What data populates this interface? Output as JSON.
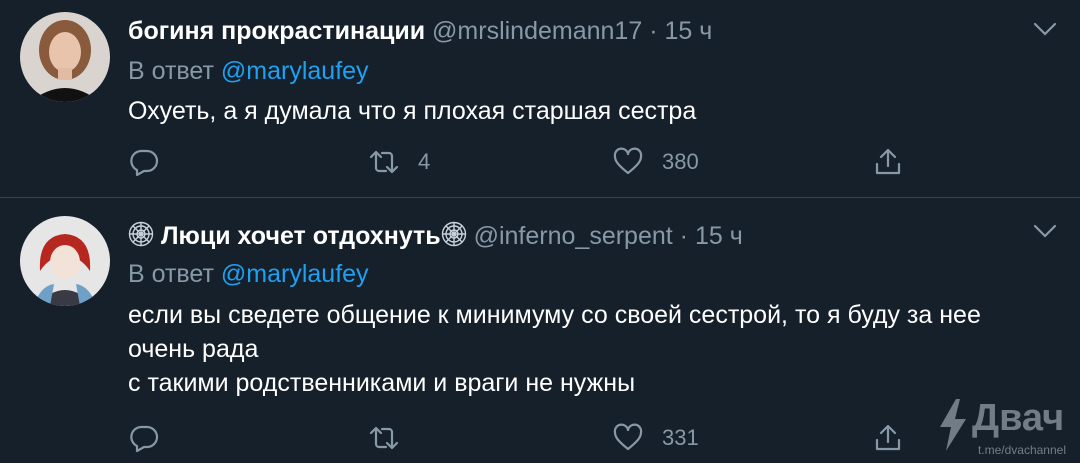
{
  "tweets": [
    {
      "name": "богиня прокрастинации",
      "handle": "@mrslindemann17",
      "dot": "·",
      "time": "15 ч",
      "reply_prefix": "В ответ",
      "reply_to": "@marylaufey",
      "text_lines": [
        "Охуеть, а я думала что я плохая старшая сестра"
      ],
      "retweets": "4",
      "likes": "380"
    },
    {
      "name": "Люци хочет отдохнуть",
      "handle": "@inferno_serpent",
      "dot": "·",
      "time": "15 ч",
      "reply_prefix": "В ответ",
      "reply_to": "@marylaufey",
      "text_lines": [
        "если вы сведете общение к минимуму со своей сестрой, то я буду за нее",
        "очень рада",
        "с такими родственниками и враги не нужны"
      ],
      "retweets": "",
      "likes": "331"
    }
  ],
  "watermark": {
    "brand": "Двач",
    "url": "t.me/dvachannel"
  },
  "colors": {
    "background": "#15202b",
    "secondary": "#8899a6",
    "accent": "#1da1f2",
    "divider": "#38444d"
  }
}
